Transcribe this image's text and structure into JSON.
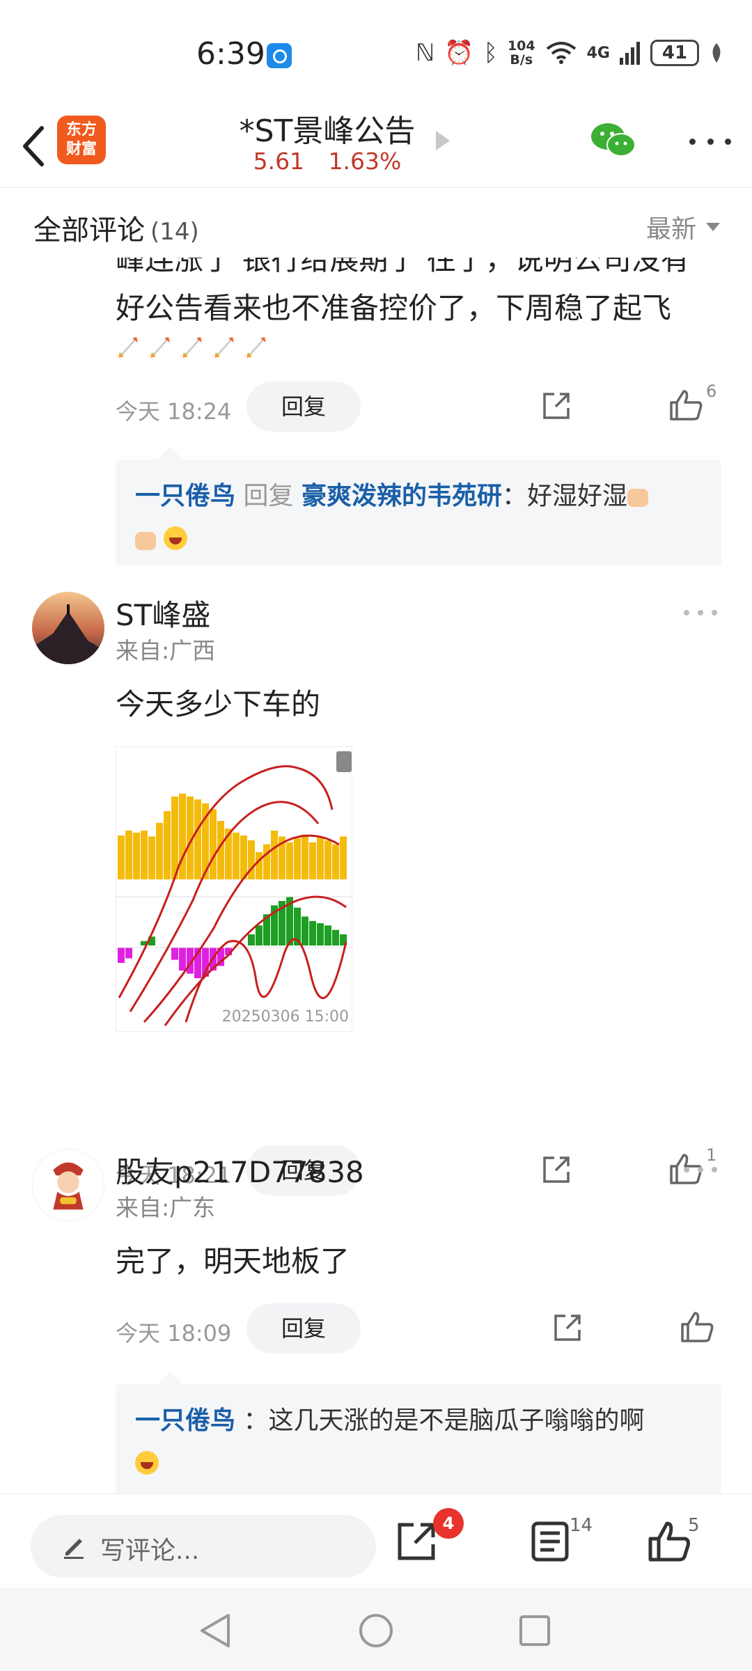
{
  "status": {
    "time": "6:39",
    "net_speed_top": "104",
    "net_speed_bottom": "B/s",
    "signal": "4G",
    "battery": "41"
  },
  "header": {
    "logo_line1": "东方",
    "logo_line2": "财富",
    "title": "*ST景峰公告",
    "price": "5.61",
    "change": "1.63%",
    "quote_color": "#c0392b"
  },
  "comments_header": {
    "title": "全部评论",
    "count": "(14)",
    "sort": "最新"
  },
  "comment0": {
    "text_line1": "峰连涨了 银行给展期了 往了，说明公司没有",
    "text_line2": "好公告看来也不准备控价了，下周稳了起飞",
    "time": "今天 18:24",
    "reply_label": "回复",
    "like_count": "6",
    "reply": {
      "user": "一只倦鸟",
      "action": "回复",
      "target": "豪爽泼辣的韦苑研",
      "text": "：好湿好湿"
    }
  },
  "comment1": {
    "username": "ST峰盛",
    "location": "来自:广西",
    "text": "今天多少下车的",
    "image_timestamp": "20250306 15:00",
    "time": "今天 18:21",
    "reply_label": "回复",
    "like_count": "1"
  },
  "comment2": {
    "username": "股友p217D77838",
    "location": "来自:广东",
    "text": "完了，明天地板了",
    "time": "今天 18:09",
    "reply_label": "回复",
    "reply": {
      "user": "一只倦鸟",
      "text": "：这几天涨的是不是脑瓜子嗡嗡的啊"
    }
  },
  "bottom_bar": {
    "write_placeholder": "写评论...",
    "share_badge": "4",
    "comments_count": "14",
    "likes_count": "5"
  },
  "accent": "#1a5fa8"
}
